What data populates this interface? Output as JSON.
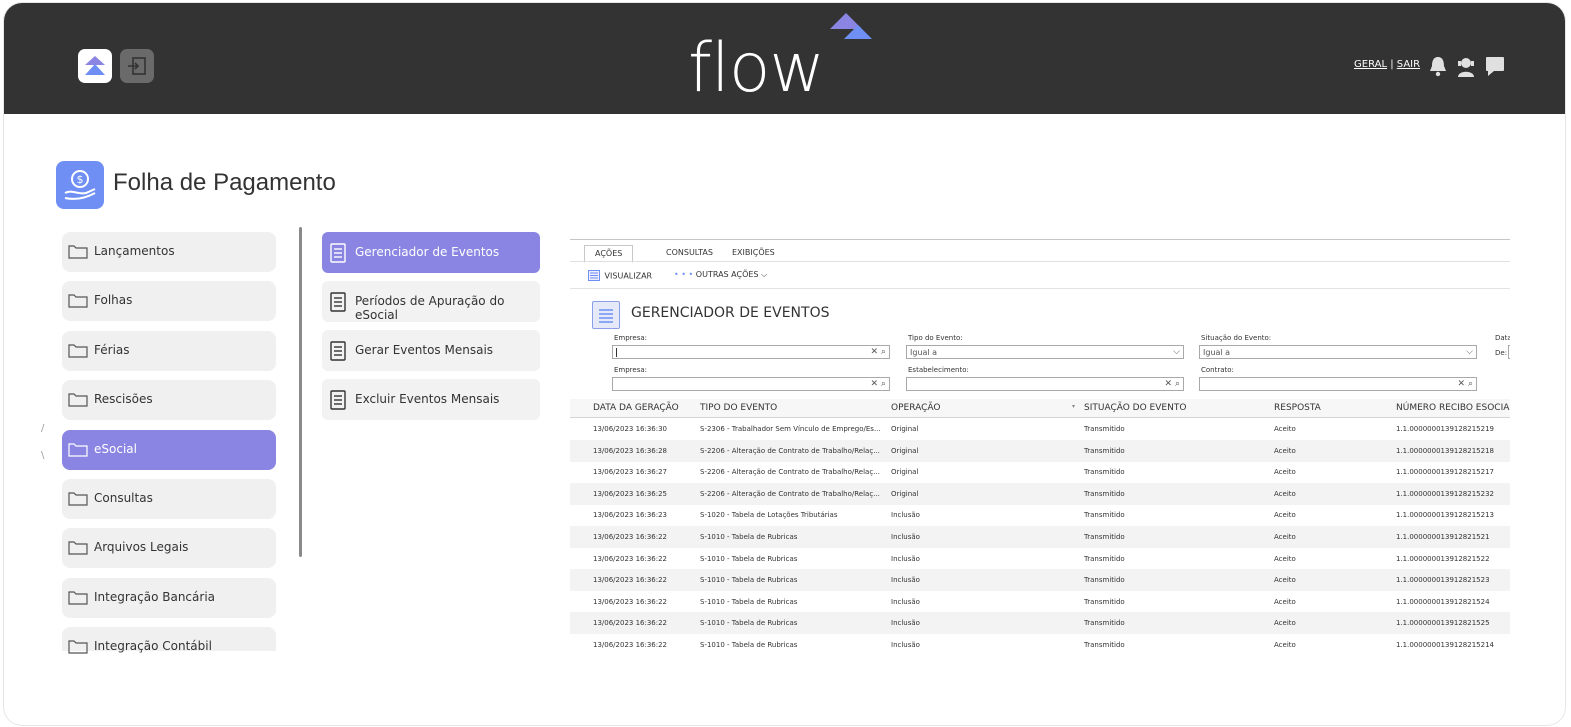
{
  "header": {
    "brand": "flow",
    "links": [
      "GERAL",
      "SAIR"
    ],
    "separator": "|",
    "colors": {
      "bar": "#333333",
      "accent": "#8a85e2",
      "blue": "#6f8ff5"
    },
    "icons": [
      "flow-logo-icon",
      "exit-icon",
      "bell-icon",
      "support-icon",
      "chat-icon"
    ]
  },
  "page": {
    "title": "Folha de Pagamento",
    "icon": "money-hand-icon"
  },
  "menu": {
    "items": [
      {
        "label": "Lançamentos"
      },
      {
        "label": "Folhas"
      },
      {
        "label": "Férias"
      },
      {
        "label": "Rescisões"
      },
      {
        "label": "eSocial",
        "active": true
      },
      {
        "label": "Consultas"
      },
      {
        "label": "Arquivos Legais"
      },
      {
        "label": "Integração Bancária"
      },
      {
        "label": "Integração Contábil"
      }
    ]
  },
  "submenu": {
    "items": [
      {
        "label": "Gerenciador de Eventos",
        "active": true
      },
      {
        "label": "Períodos de Apuração do eSocial"
      },
      {
        "label": "Gerar Eventos Mensais"
      },
      {
        "label": "Excluir Eventos Mensais"
      }
    ]
  },
  "panel": {
    "tabs": [
      "AÇÕES",
      "CONSULTAS",
      "EXIBIÇÕES"
    ],
    "toolbar": {
      "view": "VISUALIZAR",
      "more": "OUTRAS AÇÕES",
      "more_dots": "• • •"
    },
    "title": "GERENCIADOR DE EVENTOS",
    "filters": {
      "empresa_label": "Empresa:",
      "tipo_label": "Tipo do Evento:",
      "tipo_value": "Igual a",
      "situacao_label": "Situação do Evento:",
      "situacao_value": "Igual a",
      "data_label": "Data",
      "de_label": "De:",
      "empresa2_label": "Empresa:",
      "estab_label": "Estabelecimento:",
      "contrato_label": "Contrato:"
    },
    "columns": [
      "DATA DA GERAÇÃO",
      "TIPO DO EVENTO",
      "OPERAÇÃO",
      "SITUAÇÃO DO EVENTO",
      "RESPOSTA",
      "NÚMERO RECIBO ESOCIA"
    ],
    "rows": [
      [
        "13/06/2023 16:36:30",
        "S-2306 - Trabalhador Sem Vínculo de Emprego/Es...",
        "Original",
        "Transmitido",
        "Aceito",
        "1.1.0000000139128215219"
      ],
      [
        "13/06/2023 16:36:28",
        "S-2206 - Alteração de Contrato de Trabalho/Relaç...",
        "Original",
        "Transmitido",
        "Aceito",
        "1.1.0000000139128215218"
      ],
      [
        "13/06/2023 16:36:27",
        "S-2206 - Alteração de Contrato de Trabalho/Relaç...",
        "Original",
        "Transmitido",
        "Aceito",
        "1.1.0000000139128215217"
      ],
      [
        "13/06/2023 16:36:25",
        "S-2206 - Alteração de Contrato de Trabalho/Relaç...",
        "Original",
        "Transmitido",
        "Aceito",
        "1.1.0000000139128215232"
      ],
      [
        "13/06/2023 16:36:23",
        "S-1020 - Tabela de Lotações Tributárias",
        "Inclusão",
        "Transmitido",
        "Aceito",
        "1.1.0000000139128215213"
      ],
      [
        "13/06/2023 16:36:22",
        "S-1010 - Tabela de Rubricas",
        "Inclusão",
        "Transmitido",
        "Aceito",
        "1.1.000000013912821521"
      ],
      [
        "13/06/2023 16:36:22",
        "S-1010 - Tabela de Rubricas",
        "Inclusão",
        "Transmitido",
        "Aceito",
        "1.1.000000013912821522"
      ],
      [
        "13/06/2023 16:36:22",
        "S-1010 - Tabela de Rubricas",
        "Inclusão",
        "Transmitido",
        "Aceito",
        "1.1.000000013912821523"
      ],
      [
        "13/06/2023 16:36:22",
        "S-1010 - Tabela de Rubricas",
        "Inclusão",
        "Transmitido",
        "Aceito",
        "1.1.000000013912821524"
      ],
      [
        "13/06/2023 16:36:22",
        "S-1010 - Tabela de Rubricas",
        "Inclusão",
        "Transmitido",
        "Aceito",
        "1.1.000000013912821525"
      ],
      [
        "13/06/2023 16:36:22",
        "S-1010 - Tabela de Rubricas",
        "Inclusão",
        "Transmitido",
        "Aceito",
        "1.1.0000000139128215214"
      ]
    ]
  }
}
